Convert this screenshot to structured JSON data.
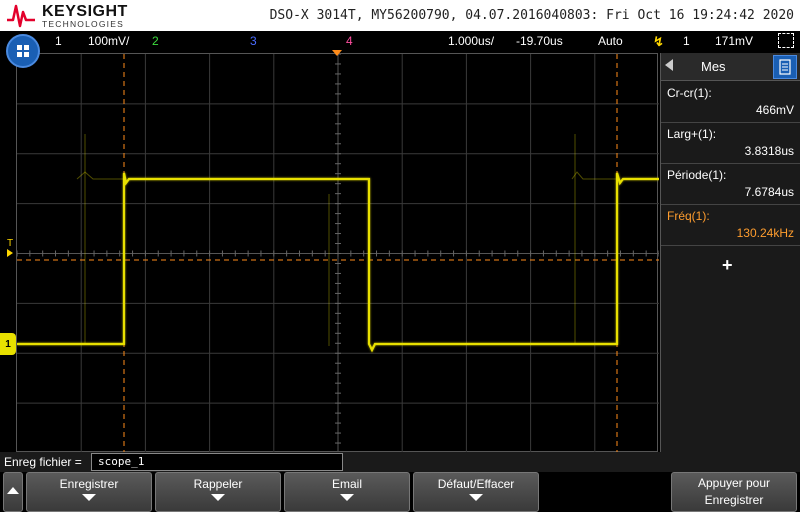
{
  "header": {
    "brand": "KEYSIGHT",
    "brand_sub": "TECHNOLOGIES",
    "device_info": "DSO-X 3014T, MY56200790, 04.07.2016040803: Fri Oct 16 19:24:42 2020"
  },
  "status": {
    "ch1_num": "1",
    "ch1_scale": "100mV/",
    "ch2_num": "2",
    "ch3_num": "3",
    "ch4_num": "4",
    "timebase": "1.000us/",
    "delay": "-19.70us",
    "trigger_mode": "Auto",
    "trigger_icon": "trigger-edge-icon",
    "trigger_source": "1",
    "trigger_level": "171mV"
  },
  "markers": {
    "ch1_marker": "1",
    "trigger_marker": "T"
  },
  "measurements": {
    "tab_label": "Mes",
    "items": [
      {
        "label": "Cr-cr(1):",
        "value": "466mV"
      },
      {
        "label": "Larg+(1):",
        "value": "3.8318us"
      },
      {
        "label": "Période(1):",
        "value": "7.6784us"
      },
      {
        "label": "Fréq(1):",
        "value": "130.24kHz"
      }
    ],
    "add_symbol": "+"
  },
  "file": {
    "label": "Enreg fichier =",
    "value": "scope_1"
  },
  "softkeys": {
    "save": "Enregistrer",
    "recall": "Rappeler",
    "email": "Email",
    "default": "Défaut/Effacer",
    "press_line1": "Appuyer pour",
    "press_line2": "Enregistrer"
  },
  "colors": {
    "ch1": "#e8e000",
    "ch2": "#3ddc3d",
    "ch3": "#4a6cff",
    "ch4": "#ff4fa0",
    "trigger": "#ffd700",
    "cursor": "#ff8c1a",
    "measurement_active": "#ff9d2e",
    "accent": "#1a5fb4"
  }
}
